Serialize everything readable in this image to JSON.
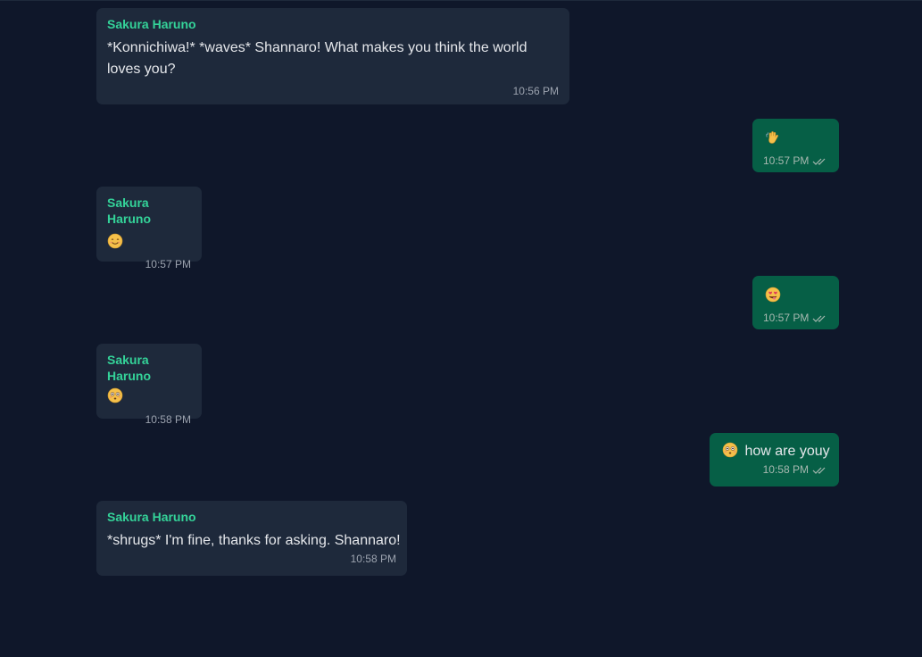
{
  "messages": [
    {
      "sender": "Sakura Haruno",
      "text": "*Konnichiwa!* *waves* Shannaro! What makes you think the world loves you?",
      "time": "10:56 PM"
    },
    {
      "text": "",
      "time": "10:57 PM",
      "emoji": "waving-hand"
    },
    {
      "sender": "Sakura Haruno",
      "text": "",
      "time": "10:57 PM",
      "emoji": "smiling-face"
    },
    {
      "text": "",
      "time": "10:57 PM",
      "emoji": "heart-eyes-tongue"
    },
    {
      "sender": "Sakura Haruno",
      "text": "",
      "time": "10:58 PM",
      "emoji": "flushed-face"
    },
    {
      "text": "how are youy",
      "time": "10:58 PM",
      "emoji": "flushed-face"
    },
    {
      "sender": "Sakura Haruno",
      "text": "*shrugs* I'm fine, thanks for asking. Shannaro!",
      "time": "10:58 PM"
    }
  ],
  "colors": {
    "background": "#0f172a",
    "incoming_bubble": "#1e293b",
    "outgoing_bubble": "#065f46",
    "sender_name": "#34d399"
  }
}
